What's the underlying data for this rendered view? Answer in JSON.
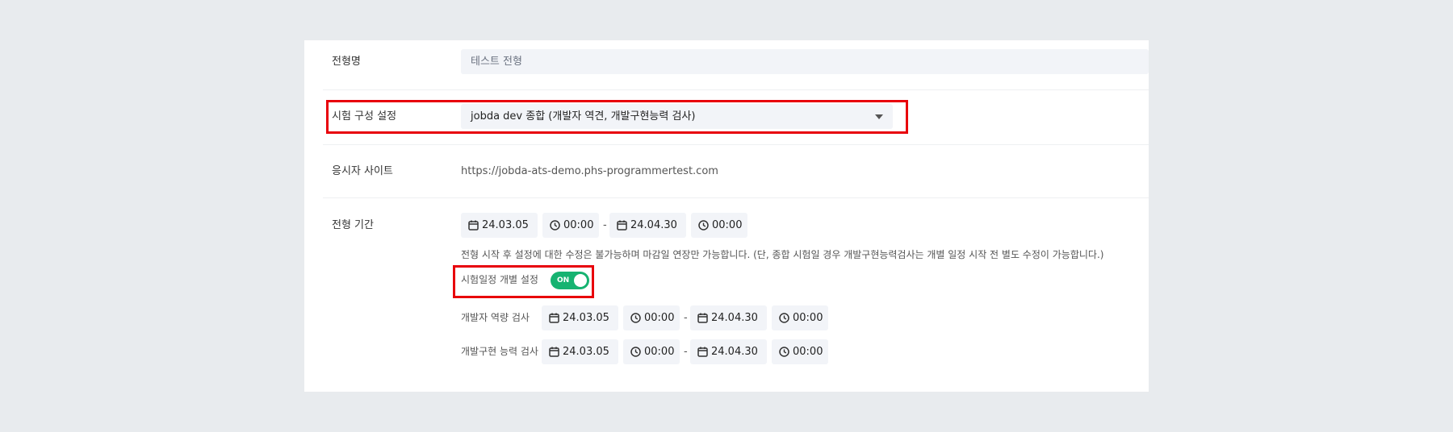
{
  "form": {
    "name": {
      "label": "전형명",
      "value": "테스트 전형"
    },
    "exam_config": {
      "label": "시험 구성 설정",
      "selected": "jobda dev 종합 (개발자 역견, 개발구현능력 검사)"
    },
    "site": {
      "label": "응시자 사이트",
      "url": "https://jobda-ats-demo.phs-programmertest.com"
    },
    "period": {
      "label": "전형 기간",
      "start_date": "24.03.05",
      "start_time": "00:00",
      "dash": "-",
      "end_date": "24.04.30",
      "end_time": "00:00",
      "note": "전형 시작 후 설정에 대한 수정은 불가능하며 마감일 연장만 가능합니다. (단, 종합 시험일 경우 개발구현능력검사는 개별 일정 시작 전 별도 수정이 가능합니다.)",
      "individual": {
        "label": "시험일정 개별 설정",
        "toggle": "ON",
        "enabled": true
      },
      "exams": [
        {
          "label": "개발자 역량 검사",
          "start_date": "24.03.05",
          "start_time": "00:00",
          "end_date": "24.04.30",
          "end_time": "00:00"
        },
        {
          "label": "개발구현 능력 검사",
          "start_date": "24.03.05",
          "start_time": "00:00",
          "end_date": "24.04.30",
          "end_time": "00:00"
        }
      ]
    }
  },
  "colors": {
    "highlight": "#e8000a",
    "toggle_on": "#16b371",
    "field_bg": "#f2f4f8"
  },
  "icons": {
    "date": "calendar-icon",
    "time": "clock-icon",
    "select": "chevron-down-icon"
  }
}
